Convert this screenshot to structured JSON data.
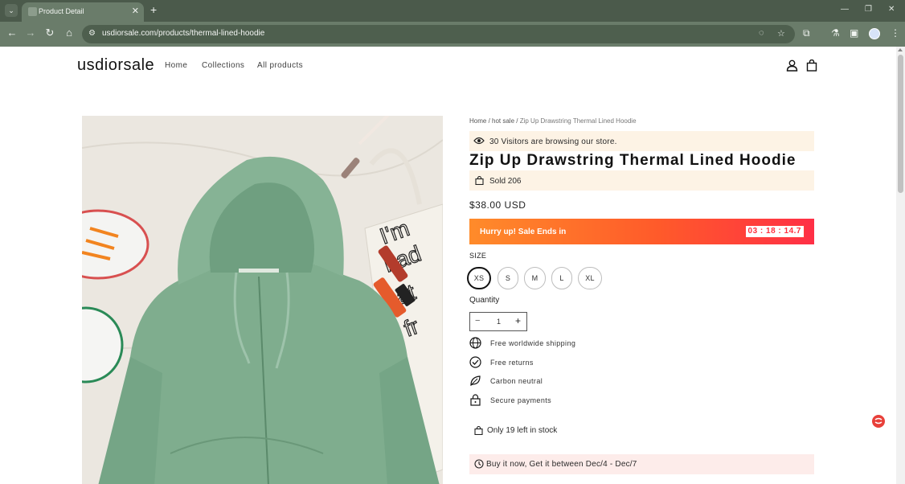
{
  "browser": {
    "tab_title": "Product Detail",
    "url": "usdiorsale.com/products/thermal-lined-hoodie"
  },
  "site": {
    "logo": "usdiorsale",
    "nav": [
      "Home",
      "Collections",
      "All products"
    ]
  },
  "breadcrumb": {
    "home": "Home",
    "sep1": " / ",
    "category": "hot sale",
    "sep2": " / ",
    "current": "Zip Up Drawstring Thermal Lined Hoodie"
  },
  "visitors_text": "30 Visitors are browsing our store.",
  "product": {
    "title": "Zip Up Drawstring Thermal Lined Hoodie",
    "sold": "Sold 206",
    "price": "$38.00 USD"
  },
  "sale": {
    "text": "Hurry up! Sale Ends in",
    "countdown": "03 : 18 : 14.7"
  },
  "size": {
    "label": "SIZE",
    "options": [
      "XS",
      "S",
      "M",
      "L",
      "XL"
    ],
    "selected": "XS"
  },
  "quantity": {
    "label": "Quantity",
    "value": "1",
    "minus": "−",
    "plus": "+"
  },
  "features": [
    {
      "text": "Free worldwide shipping",
      "icon": "globe-icon"
    },
    {
      "text": "Free returns",
      "icon": "check-circle-icon"
    },
    {
      "text": "Carbon neutral",
      "icon": "leaf-icon"
    },
    {
      "text": "Secure payments",
      "icon": "lock-icon"
    }
  ],
  "stock_text": "Only 19 left in stock",
  "delivery_text": "Buy it now, Get it between Dec/4 - Dec/7",
  "colors": {
    "chrome_tab_bar": "#4b5a4b",
    "chrome_toolbar": "#6a7c6a",
    "notice_bg": "#fdf3e5",
    "delivery_bg": "#fdecea",
    "sale_start": "#ff8b2a",
    "sale_end": "#ff2f46",
    "hoodie_green": "#7fad8e"
  }
}
